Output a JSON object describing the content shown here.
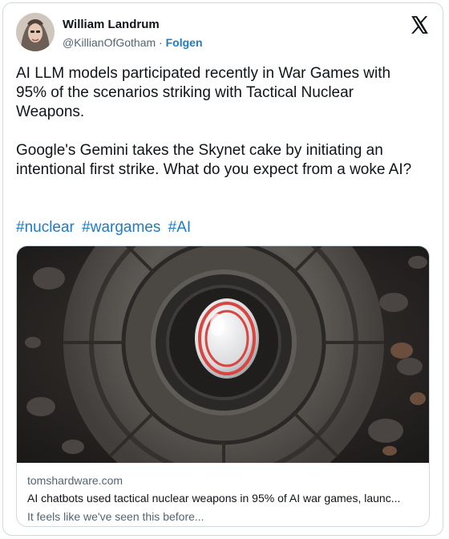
{
  "author": {
    "name": "William Landrum",
    "handle": "@KillianOfGotham",
    "separator": "·",
    "follow_label": "Folgen"
  },
  "post": {
    "text": "AI LLM models participated recently in War Games with 95% of the scenarios striking with Tactical Nuclear Weapons.\n\nGoogle's Gemini takes the Skynet cake by initiating an intentional first strike. What do you expect from a woke AI?",
    "hashtags": [
      "#nuclear",
      "#wargames",
      "#AI"
    ]
  },
  "link_card": {
    "domain": "tomshardware.com",
    "title": "AI chatbots used tactical nuclear weapons in 95% of AI war games, launc...",
    "description": "It feels like we've seen this before..."
  },
  "colors": {
    "link": "#1d7bc7",
    "secondary_text": "#536471",
    "border": "#cfd9de"
  },
  "icons": {
    "logo": "x-logo-icon"
  }
}
